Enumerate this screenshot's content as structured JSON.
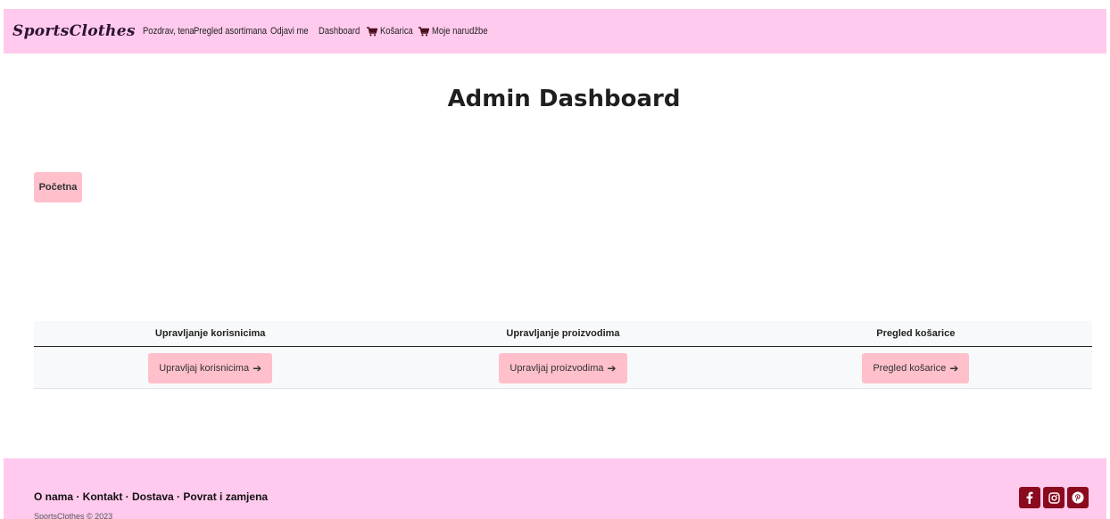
{
  "navbar": {
    "brand": "SportsClothes",
    "links": [
      {
        "label": "Pozdrav, tena"
      },
      {
        "label": "Pregled asortimana"
      },
      {
        "label": "Odjavi me"
      },
      {
        "label": "Dashboard"
      },
      {
        "label": "Košarica",
        "icon": "cart-icon"
      },
      {
        "label": "Moje narudžbe",
        "icon": "cart-icon"
      }
    ]
  },
  "page": {
    "title": "Admin Dashboard",
    "home_button": "Početna"
  },
  "table": {
    "headers": [
      "Upravljanje korisnicima",
      "Upravljanje proizvodima",
      "Pregled košarice"
    ],
    "actions": [
      "Upravljaj korisnicima",
      "Upravljaj proizvodima",
      "Pregled košarice"
    ]
  },
  "footer": {
    "links": "O nama · Kontakt · Dostava · Povrat i zamjena",
    "copyright": "SportsClothes © 2023",
    "social": [
      "facebook-icon",
      "instagram-icon",
      "pinterest-icon"
    ]
  },
  "colors": {
    "navbar_bg": "#ffcaed",
    "button_bg": "#ffc0cb",
    "social_bg": "#8b0a1e"
  }
}
